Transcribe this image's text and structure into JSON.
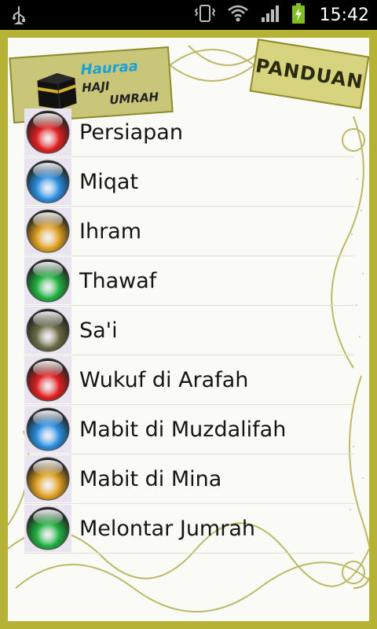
{
  "status_bar": {
    "time": "15:42",
    "icons": [
      "usb-icon",
      "vibrate-icon",
      "wifi-icon",
      "signal-icon",
      "battery-charging-icon"
    ]
  },
  "header": {
    "logo_words": [
      "Hauraa",
      "HAJI",
      "UMRAH"
    ],
    "panduan_label": "PANDUAN"
  },
  "menu": {
    "items": [
      {
        "label": "Persiapan",
        "color": "#e02020"
      },
      {
        "label": "Miqat",
        "color": "#2a8fe0"
      },
      {
        "label": "Ihram",
        "color": "#e0a020"
      },
      {
        "label": "Thawaf",
        "color": "#20b040"
      },
      {
        "label": "Sa'i",
        "color": "#6b6b45"
      },
      {
        "label": "Wukuf di Arafah",
        "color": "#e02020"
      },
      {
        "label": "Mabit di Muzdalifah",
        "color": "#2a8fe0"
      },
      {
        "label": "Mabit di Mina",
        "color": "#e0a020"
      },
      {
        "label": "Melontar Jumrah",
        "color": "#20b040"
      }
    ]
  },
  "colors": {
    "frame": "#b5b236",
    "background": "#fafbf6",
    "divider": "#dedfd6"
  }
}
